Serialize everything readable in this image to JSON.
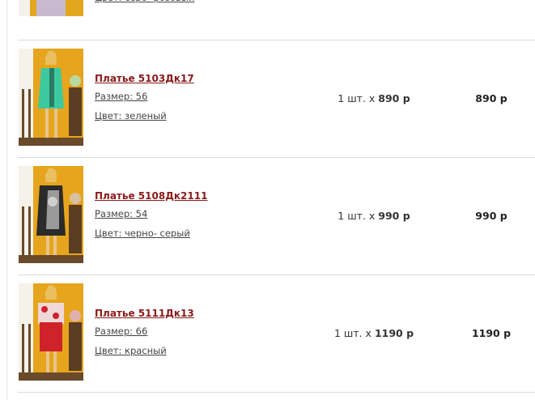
{
  "items": [
    {
      "name": "",
      "size": "",
      "color": "Цвет: серо- розовый",
      "qty": "",
      "unit_price": "",
      "total": "",
      "dress_color": "#c8b8d0"
    },
    {
      "name": "Платье 5103Дк17",
      "size": "Размер: 56",
      "color": "Цвет: зеленый",
      "qty": "1 шт. х",
      "unit_price": "890 р",
      "total": "890 р",
      "dress_color": "#3cc9a0"
    },
    {
      "name": "Платье 5108Дк2111",
      "size": "Размер: 54",
      "color": "Цвет: черно- серый",
      "qty": "1 шт. х",
      "unit_price": "990 р",
      "total": "990 р",
      "dress_color": "#2b2b2b"
    },
    {
      "name": "Платье 5111Дк13",
      "size": "Размер: 66",
      "color": "Цвет: красный",
      "qty": "1 шт. х",
      "unit_price": "1190 р",
      "total": "1190 р",
      "dress_color": "#d0222a"
    }
  ],
  "colors": {
    "link": "#8b1a1a",
    "thumb_background": "#e6a51c",
    "separator": "#dcdcdc"
  }
}
